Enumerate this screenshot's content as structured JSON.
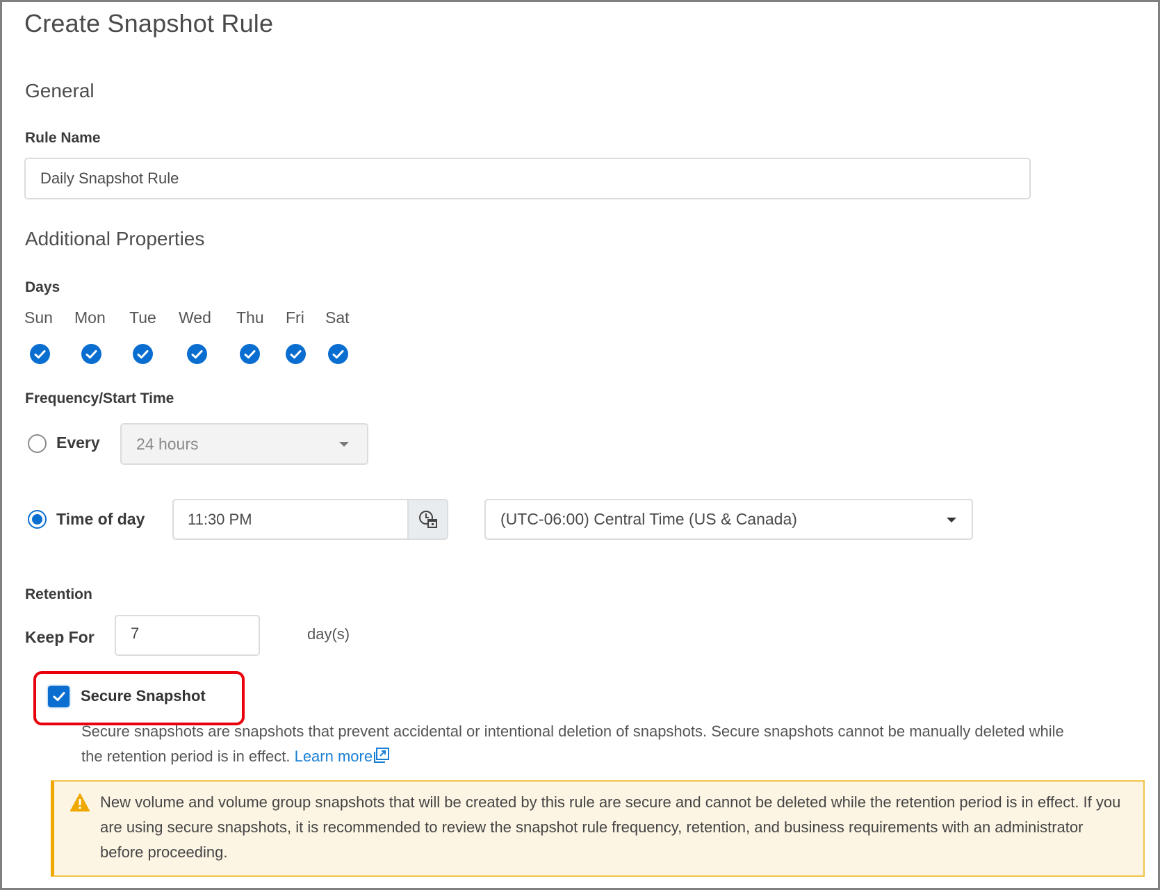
{
  "page": {
    "title": "Create Snapshot Rule"
  },
  "general": {
    "section_title": "General",
    "rule_name_label": "Rule Name",
    "rule_name_value": "Daily Snapshot Rule"
  },
  "additional": {
    "section_title": "Additional Properties",
    "days_label": "Days",
    "days": [
      {
        "label": "Sun",
        "checked": true
      },
      {
        "label": "Mon",
        "checked": true
      },
      {
        "label": "Tue",
        "checked": true
      },
      {
        "label": "Wed",
        "checked": true
      },
      {
        "label": "Thu",
        "checked": true
      },
      {
        "label": "Fri",
        "checked": true
      },
      {
        "label": "Sat",
        "checked": true
      }
    ],
    "frequency_label": "Frequency/Start Time",
    "every": {
      "label": "Every",
      "selected": false,
      "value": "24 hours",
      "disabled": true
    },
    "time_of_day": {
      "label": "Time of day",
      "selected": true,
      "value": "11:30 PM",
      "icon": "clock-calendar-icon",
      "timezone": "(UTC-06:00) Central Time (US & Canada)"
    },
    "retention": {
      "label": "Retention",
      "keep_for_label": "Keep For",
      "keep_for_value": "7",
      "unit": "day(s)"
    },
    "secure_snapshot": {
      "label": "Secure Snapshot",
      "checked": true,
      "description": "Secure snapshots are snapshots that prevent accidental or intentional deletion of snapshots. Secure snapshots cannot be manually deleted while the retention period is in effect.",
      "link_label": "Learn more",
      "link_icon": "external-link-icon"
    },
    "warning": {
      "icon": "warning-triangle-icon",
      "text": "New volume and volume group snapshots that will be created by this rule are secure and cannot be deleted while the retention period is in effect. If you are using secure snapshots, it is recommended to review the snapshot rule frequency, retention, and business requirements with an administrator before proceeding."
    }
  },
  "colors": {
    "accent": "#0a6ed1",
    "highlight": "#e8000b",
    "warning": "#efa800",
    "warning_bg": "#fdf5e4",
    "link": "#1a7fd4"
  }
}
